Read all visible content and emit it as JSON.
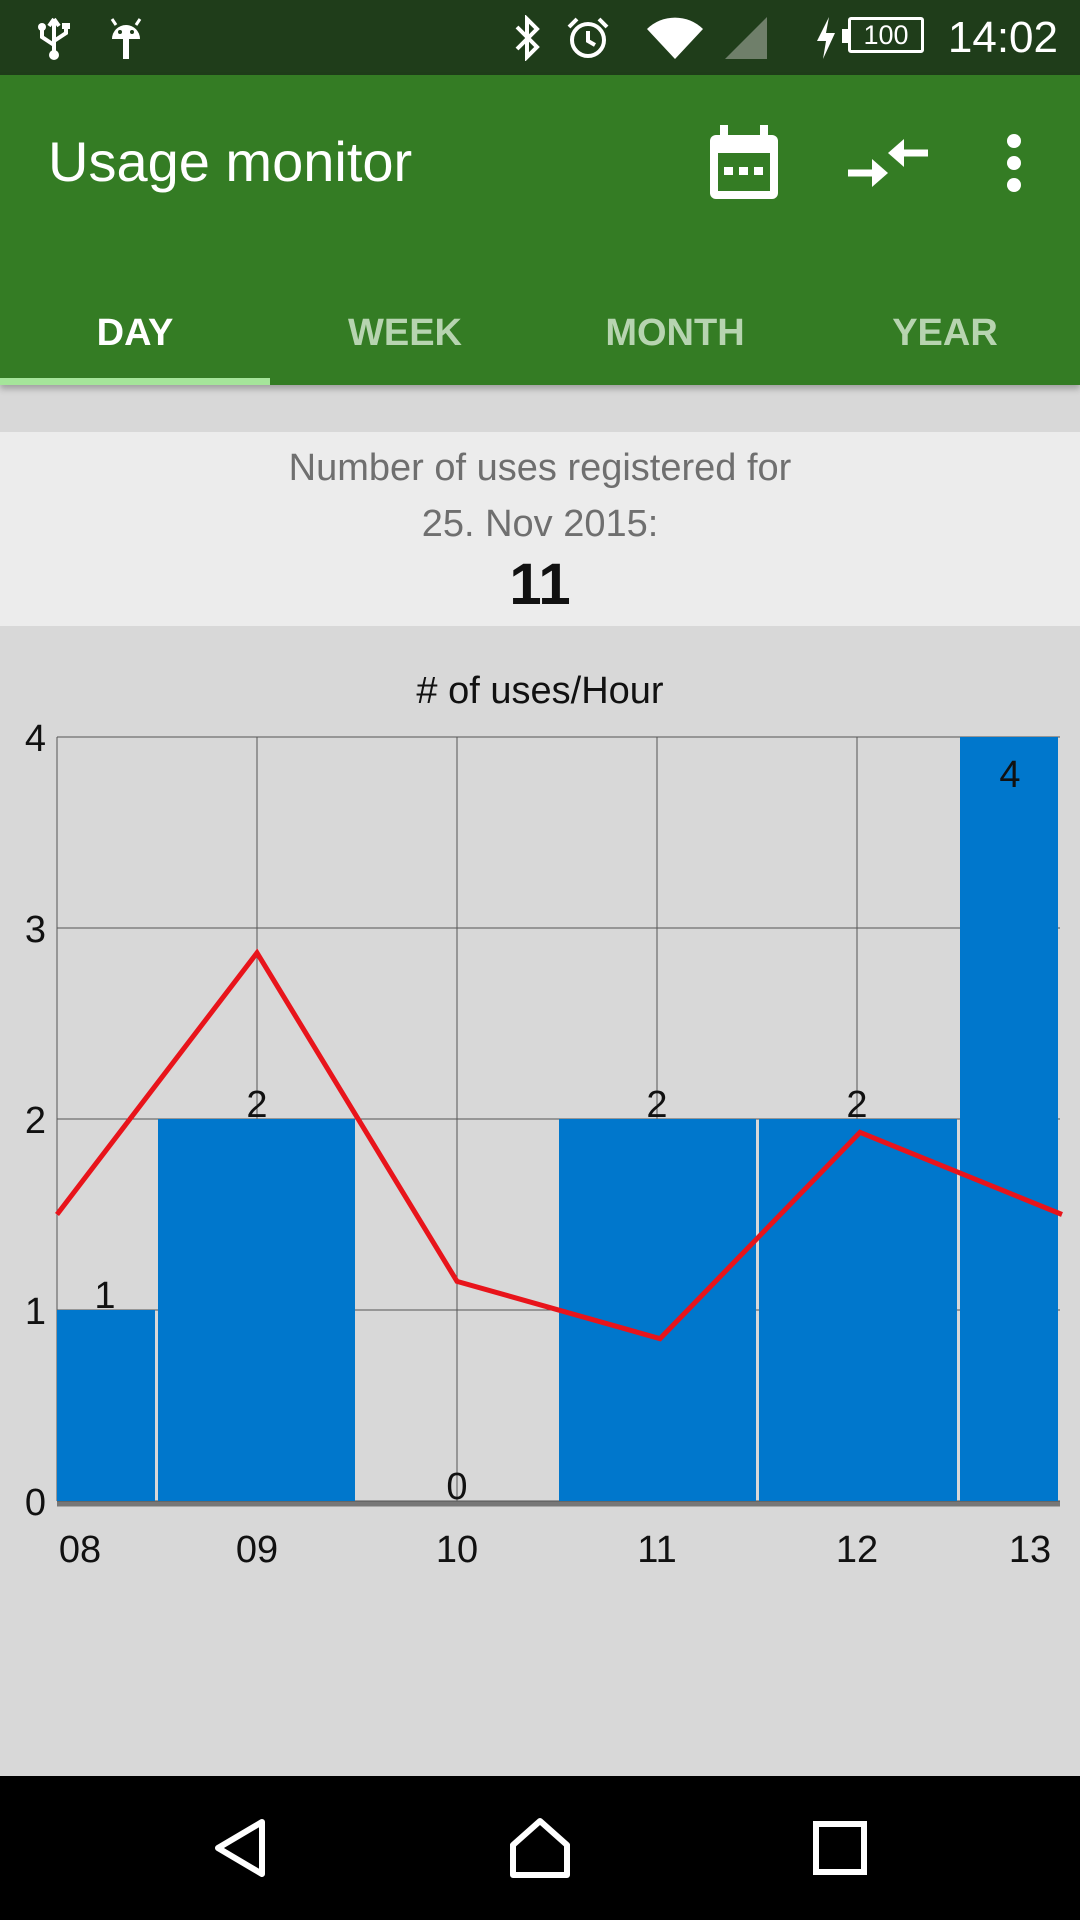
{
  "status_bar": {
    "time": "14:02",
    "battery_level": "100",
    "icons": [
      "usb-icon",
      "android-icon",
      "bluetooth-icon",
      "alarm-icon",
      "wifi-icon",
      "signal-icon",
      "charging-icon",
      "battery-icon"
    ]
  },
  "app_bar": {
    "title": "Usage monitor",
    "actions": [
      "calendar-icon",
      "compare-icon",
      "more-vert-icon"
    ],
    "background": "#347c24"
  },
  "tabs": [
    {
      "label": "DAY",
      "active": true
    },
    {
      "label": "WEEK",
      "active": false
    },
    {
      "label": "MONTH",
      "active": false
    },
    {
      "label": "YEAR",
      "active": false
    }
  ],
  "summary": {
    "label": "Number of uses registered for",
    "date": "25. Nov 2015:",
    "count": "11"
  },
  "chart_data": {
    "type": "bar",
    "title": "# of uses/Hour",
    "xlabel": "",
    "ylabel": "",
    "categories": [
      "08",
      "09",
      "10",
      "11",
      "12",
      "13"
    ],
    "y_ticks": [
      "0",
      "1",
      "2",
      "3",
      "4"
    ],
    "ylim": [
      0,
      4
    ],
    "grid": true,
    "bar_color": "#0077cc",
    "line_color": "#e8141b",
    "series": [
      {
        "type": "bar",
        "values": [
          1,
          2,
          0,
          2,
          2,
          4
        ]
      },
      {
        "type": "line",
        "values": [
          1.5,
          2.87,
          1.15,
          0.85,
          1.93,
          1.5
        ]
      }
    ],
    "data_labels": [
      "1",
      "2",
      "0",
      "2",
      "2",
      "4"
    ]
  },
  "nav_bar": {
    "buttons": [
      "back-icon",
      "home-icon",
      "recents-icon"
    ]
  }
}
